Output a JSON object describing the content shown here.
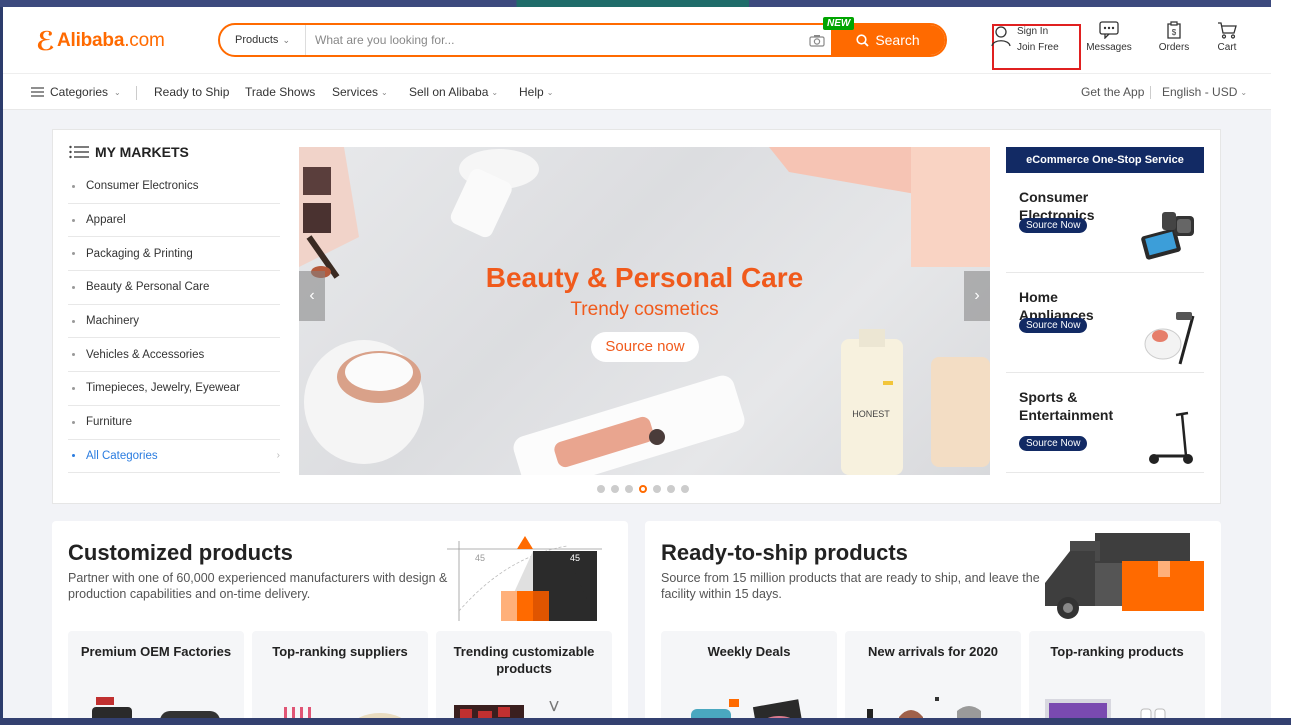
{
  "header": {
    "logo_text": "Alibaba",
    "logo_com": ".com",
    "search": {
      "category": "Products",
      "placeholder": "What are you looking for...",
      "button_label": "Search",
      "new_badge": "NEW"
    },
    "account": {
      "sign_in": "Sign In",
      "join_free": "Join Free"
    },
    "messages_label": "Messages",
    "orders_label": "Orders",
    "cart_label": "Cart"
  },
  "nav": {
    "categories": "Categories",
    "ready_to_ship": "Ready to Ship",
    "trade_shows": "Trade Shows",
    "services": "Services",
    "sell": "Sell on Alibaba",
    "help": "Help",
    "get_app": "Get the App",
    "language": "English - USD"
  },
  "markets": {
    "title": "MY MARKETS",
    "items": [
      "Consumer Electronics",
      "Apparel",
      "Packaging & Printing",
      "Beauty & Personal Care",
      "Machinery",
      "Vehicles & Accessories",
      "Timepieces, Jewelry, Eyewear",
      "Furniture",
      "All Categories"
    ]
  },
  "banner": {
    "title": "Beauty & Personal Care",
    "subtitle": "Trendy cosmetics",
    "button": "Source now",
    "product_label": "HONEST",
    "slide_index": 4,
    "slide_count": 7
  },
  "ecommerce": {
    "title": "eCommerce One-Stop Service",
    "items": [
      {
        "name": "Consumer Electronics",
        "button": "Source Now"
      },
      {
        "name": "Home Appliances",
        "button": "Source Now"
      },
      {
        "name": "Sports & Entertainment",
        "button": "Source Now"
      }
    ]
  },
  "customized": {
    "title": "Customized products",
    "desc": "Partner with one of 60,000 experienced manufacturers with design & production capabilities and on-time delivery.",
    "angle": "45",
    "subs": [
      "Premium OEM Factories",
      "Top-ranking suppliers",
      "Trending customizable products"
    ]
  },
  "ready": {
    "title": "Ready-to-ship products",
    "desc": "Source from 15 million products that are ready to ship, and leave the facility within 15 days.",
    "subs": [
      "Weekly Deals",
      "New arrivals for 2020",
      "Top-ranking products"
    ]
  },
  "colors": {
    "brand": "#ff6a00",
    "navy": "#122a64",
    "link": "#2a7ce0",
    "highlight": "#e02020"
  }
}
